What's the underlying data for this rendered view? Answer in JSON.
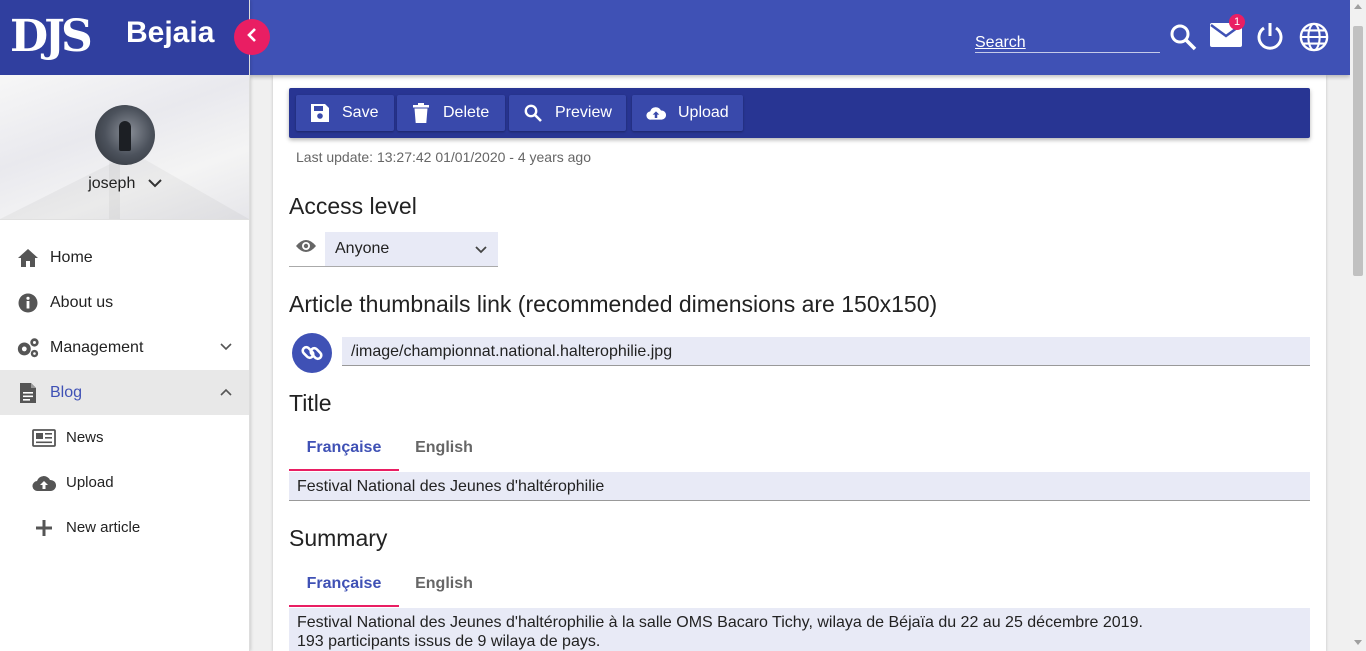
{
  "brand": {
    "logo_text": "DJS",
    "city": "Bejaia"
  },
  "user": {
    "name": "joseph"
  },
  "sidebar": {
    "items": [
      {
        "label": "Home"
      },
      {
        "label": "About us"
      },
      {
        "label": "Management"
      },
      {
        "label": "Blog"
      }
    ],
    "blog_sub": [
      {
        "label": "News"
      },
      {
        "label": "Upload"
      },
      {
        "label": "New article"
      }
    ]
  },
  "topbar": {
    "search_placeholder": "Search",
    "mail_badge": "1"
  },
  "toolbar": {
    "save": "Save",
    "delete": "Delete",
    "preview": "Preview",
    "upload": "Upload"
  },
  "last_update": "Last update: 13:27:42 01/01/2020 - 4 years ago",
  "access": {
    "title": "Access level",
    "value": "Anyone"
  },
  "thumbnail": {
    "title": "Article thumbnails link (recommended dimensions are 150x150)",
    "value": "/image/championnat.national.halterophilie.jpg"
  },
  "title_section": {
    "title": "Title",
    "tabs": [
      "Française",
      "English"
    ],
    "value": "Festival National des Jeunes d'haltérophilie"
  },
  "summary_section": {
    "title": "Summary",
    "tabs": [
      "Française",
      "English"
    ],
    "line1": "Festival National des Jeunes d'haltérophilie à la salle OMS Bacaro Tichy, wilaya de Béjaïa du 22 au 25 décembre 2019.",
    "line2": "193 participants issus de 9 wilaya de pays."
  },
  "colors": {
    "primary": "#3f51b5",
    "toolbar": "#283593",
    "accent": "#e91e63",
    "field_bg": "#e8eaf6"
  }
}
